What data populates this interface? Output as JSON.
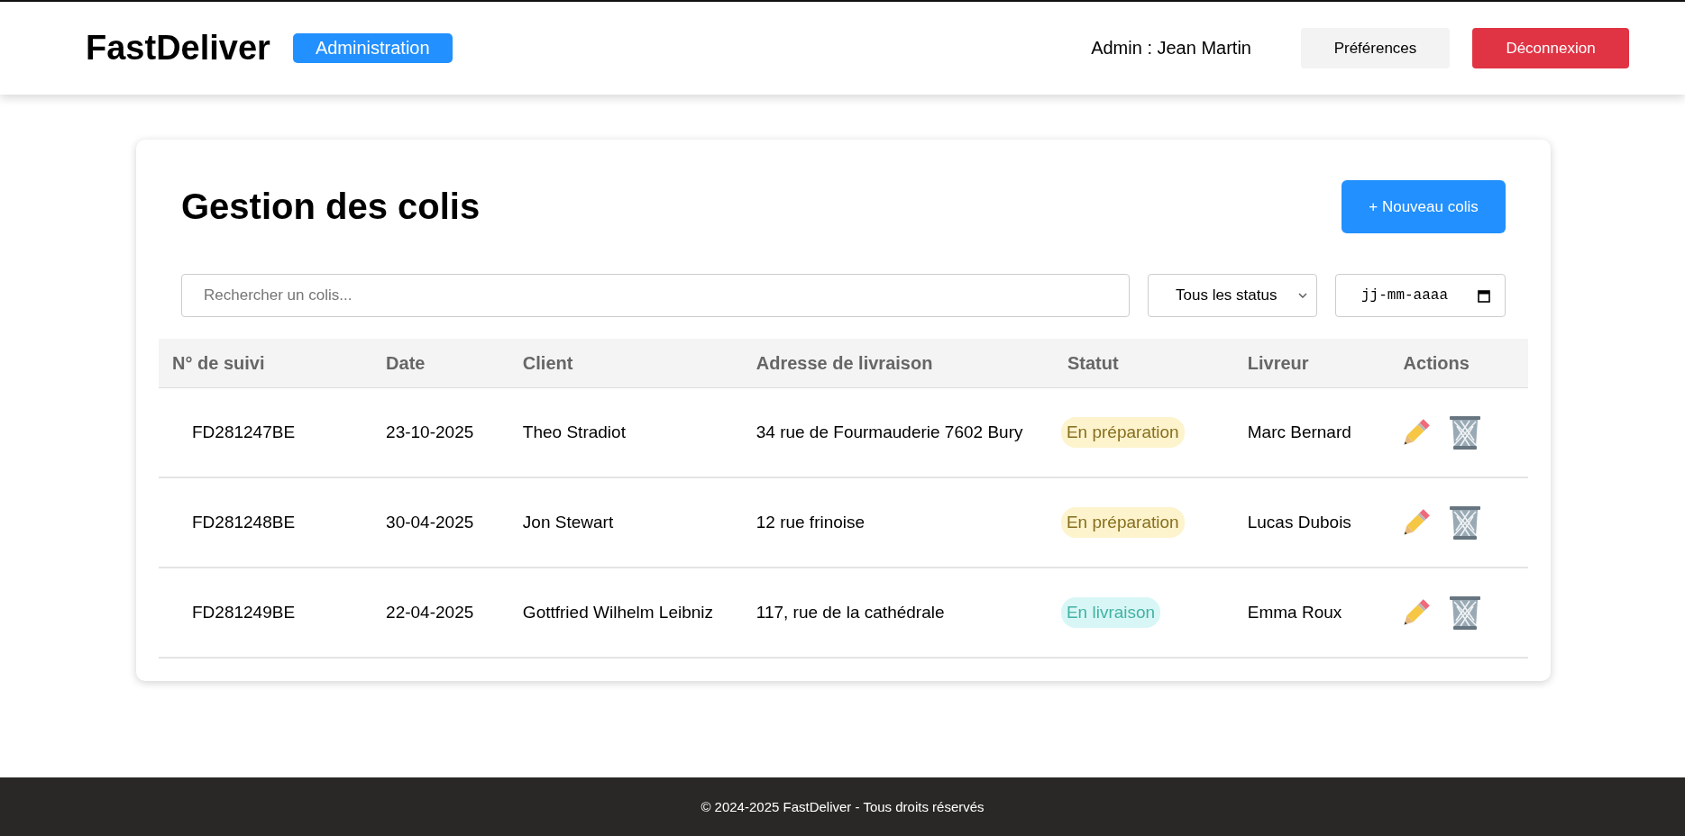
{
  "header": {
    "logo": "FastDeliver",
    "badge": "Administration",
    "user": "Admin : Jean Martin",
    "buttons": [
      {
        "label": "Préférences",
        "kind": "secondary"
      },
      {
        "label": "Déconnexion",
        "kind": "danger"
      }
    ]
  },
  "page": {
    "title": "Gestion des colis",
    "new_button": "+ Nouveau colis"
  },
  "filters": {
    "search": {
      "placeholder": "Rechercher un colis..."
    },
    "status_select": {
      "value": "Tous les status"
    },
    "date": {
      "placeholder": "jj-mm-aaaa"
    }
  },
  "table": {
    "columns": [
      "N° de suivi",
      "Date",
      "Client",
      "Adresse de livraison",
      "Statut",
      "Livreur",
      "Actions"
    ],
    "rows": [
      {
        "tracking": "FD281247BE",
        "date": "23-10-2025",
        "client": "Theo Stradiot",
        "address": "34 rue de Fourmauderie 7602 Bury",
        "status": {
          "label": "En préparation",
          "kind": "preparation"
        },
        "courier": "Marc Bernard"
      },
      {
        "tracking": "FD281248BE",
        "date": "30-04-2025",
        "client": "Jon Stewart",
        "address": "12 rue frinoise",
        "status": {
          "label": "En préparation",
          "kind": "preparation"
        },
        "courier": "Lucas Dubois"
      },
      {
        "tracking": "FD281249BE",
        "date": "22-04-2025",
        "client": "Gottfried Wilhelm Leibniz",
        "address": "117, rue de la cathédrale",
        "status": {
          "label": "En livraison",
          "kind": "delivery"
        },
        "courier": "Emma Roux"
      }
    ]
  },
  "footer": "© 2024-2025 FastDeliver - Tous droits réservés"
}
